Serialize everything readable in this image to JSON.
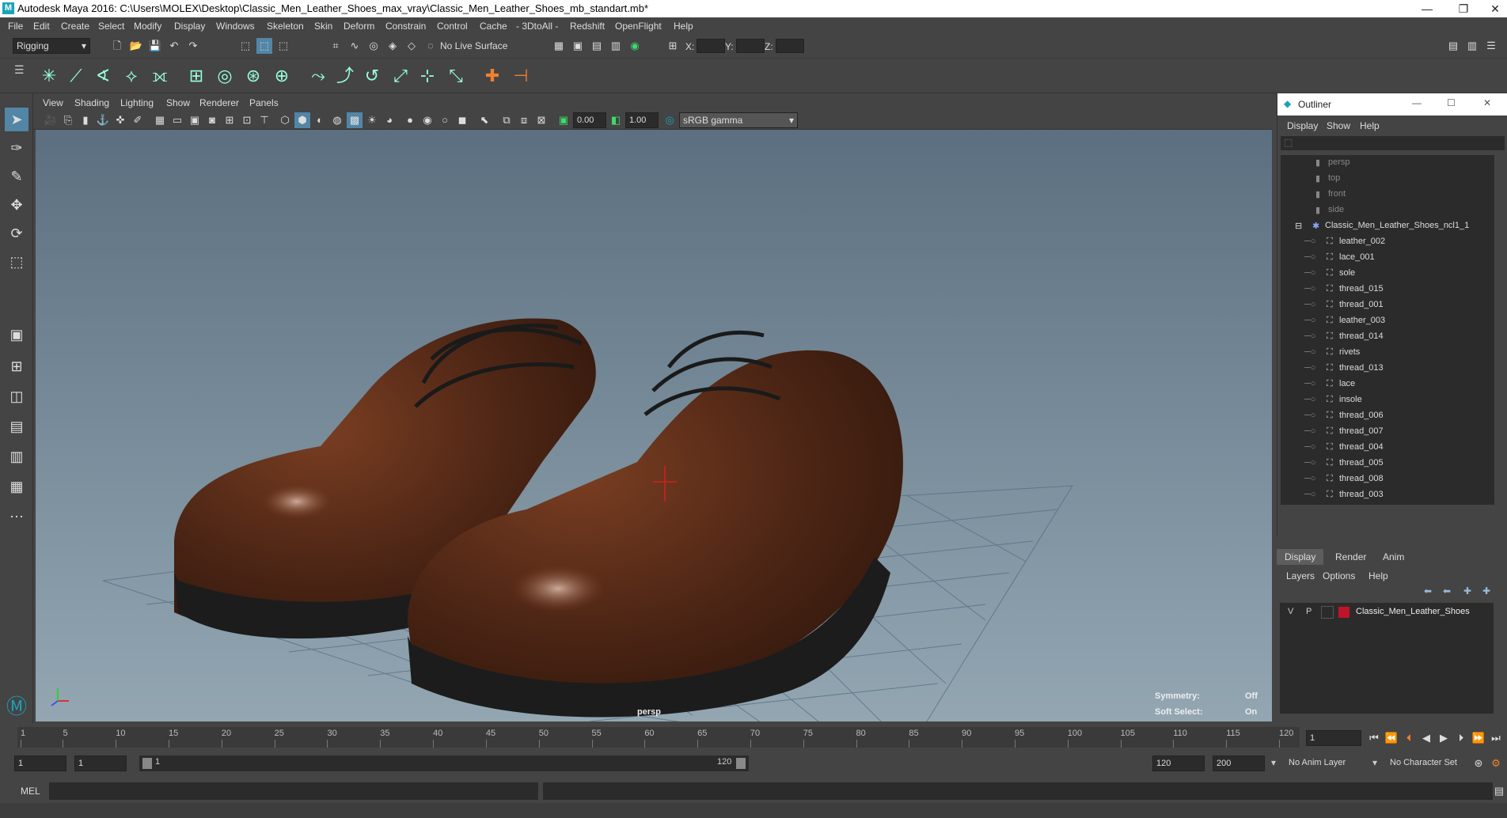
{
  "app": {
    "title": "Autodesk Maya 2016: C:\\Users\\MOLEX\\Desktop\\Classic_Men_Leather_Shoes_max_vray\\Classic_Men_Leather_Shoes_mb_standart.mb*",
    "logo": "M",
    "min": "—",
    "restore": "❐",
    "close": "✕"
  },
  "menu": [
    "File",
    "Edit",
    "Create",
    "Select",
    "Modify",
    "Display",
    "Windows",
    "Skeleton",
    "Skin",
    "Deform",
    "Constrain",
    "Control",
    "Cache",
    "- 3DtoAll -",
    "Redshift",
    "OpenFlight",
    "Help"
  ],
  "status": {
    "mode": "Rigging",
    "live_surface": "No Live Surface",
    "x_label": "X:",
    "y_label": "Y:",
    "z_label": "Z:"
  },
  "viewport": {
    "menu": [
      "View",
      "Shading",
      "Lighting",
      "Show",
      "Renderer",
      "Panels"
    ],
    "exposure": "0.00",
    "gamma": "1.00",
    "colorspace": "sRGB gamma",
    "camera": "persp",
    "symmetry_label": "Symmetry:",
    "symmetry_value": "Off",
    "soft_select_label": "Soft Select:",
    "soft_select_value": "On"
  },
  "outliner": {
    "title": "Outliner",
    "menu": [
      "Display",
      "Show",
      "Help"
    ],
    "cameras": [
      "persp",
      "top",
      "front",
      "side"
    ],
    "group": "Classic_Men_Leather_Shoes_ncl1_1",
    "children": [
      "leather_002",
      "lace_001",
      "sole",
      "thread_015",
      "thread_001",
      "leather_003",
      "thread_014",
      "rivets",
      "thread_013",
      "lace",
      "insole",
      "thread_006",
      "thread_007",
      "thread_004",
      "thread_005",
      "thread_008",
      "thread_003"
    ]
  },
  "layers": {
    "tabs": [
      "Display",
      "Render",
      "Anim"
    ],
    "menu": [
      "Layers",
      "Options",
      "Help"
    ],
    "layer_v": "V",
    "layer_p": "P",
    "layer_name": "Classic_Men_Leather_Shoes",
    "layer_color": "#c0142a"
  },
  "timeline": {
    "ticks": [
      "1",
      "5",
      "10",
      "15",
      "20",
      "25",
      "30",
      "35",
      "40",
      "45",
      "50",
      "55",
      "60",
      "65",
      "70",
      "75",
      "80",
      "85",
      "90",
      "95",
      "100",
      "105",
      "110",
      "115",
      "120"
    ],
    "current_frame": "1"
  },
  "range": {
    "start": "1",
    "playback_start": "1",
    "slider_start": "1",
    "slider_end": "120",
    "end": "120",
    "anim_end": "200",
    "anim_layer": "No Anim Layer",
    "character_set": "No Character Set"
  },
  "cmd": {
    "label": "MEL"
  }
}
